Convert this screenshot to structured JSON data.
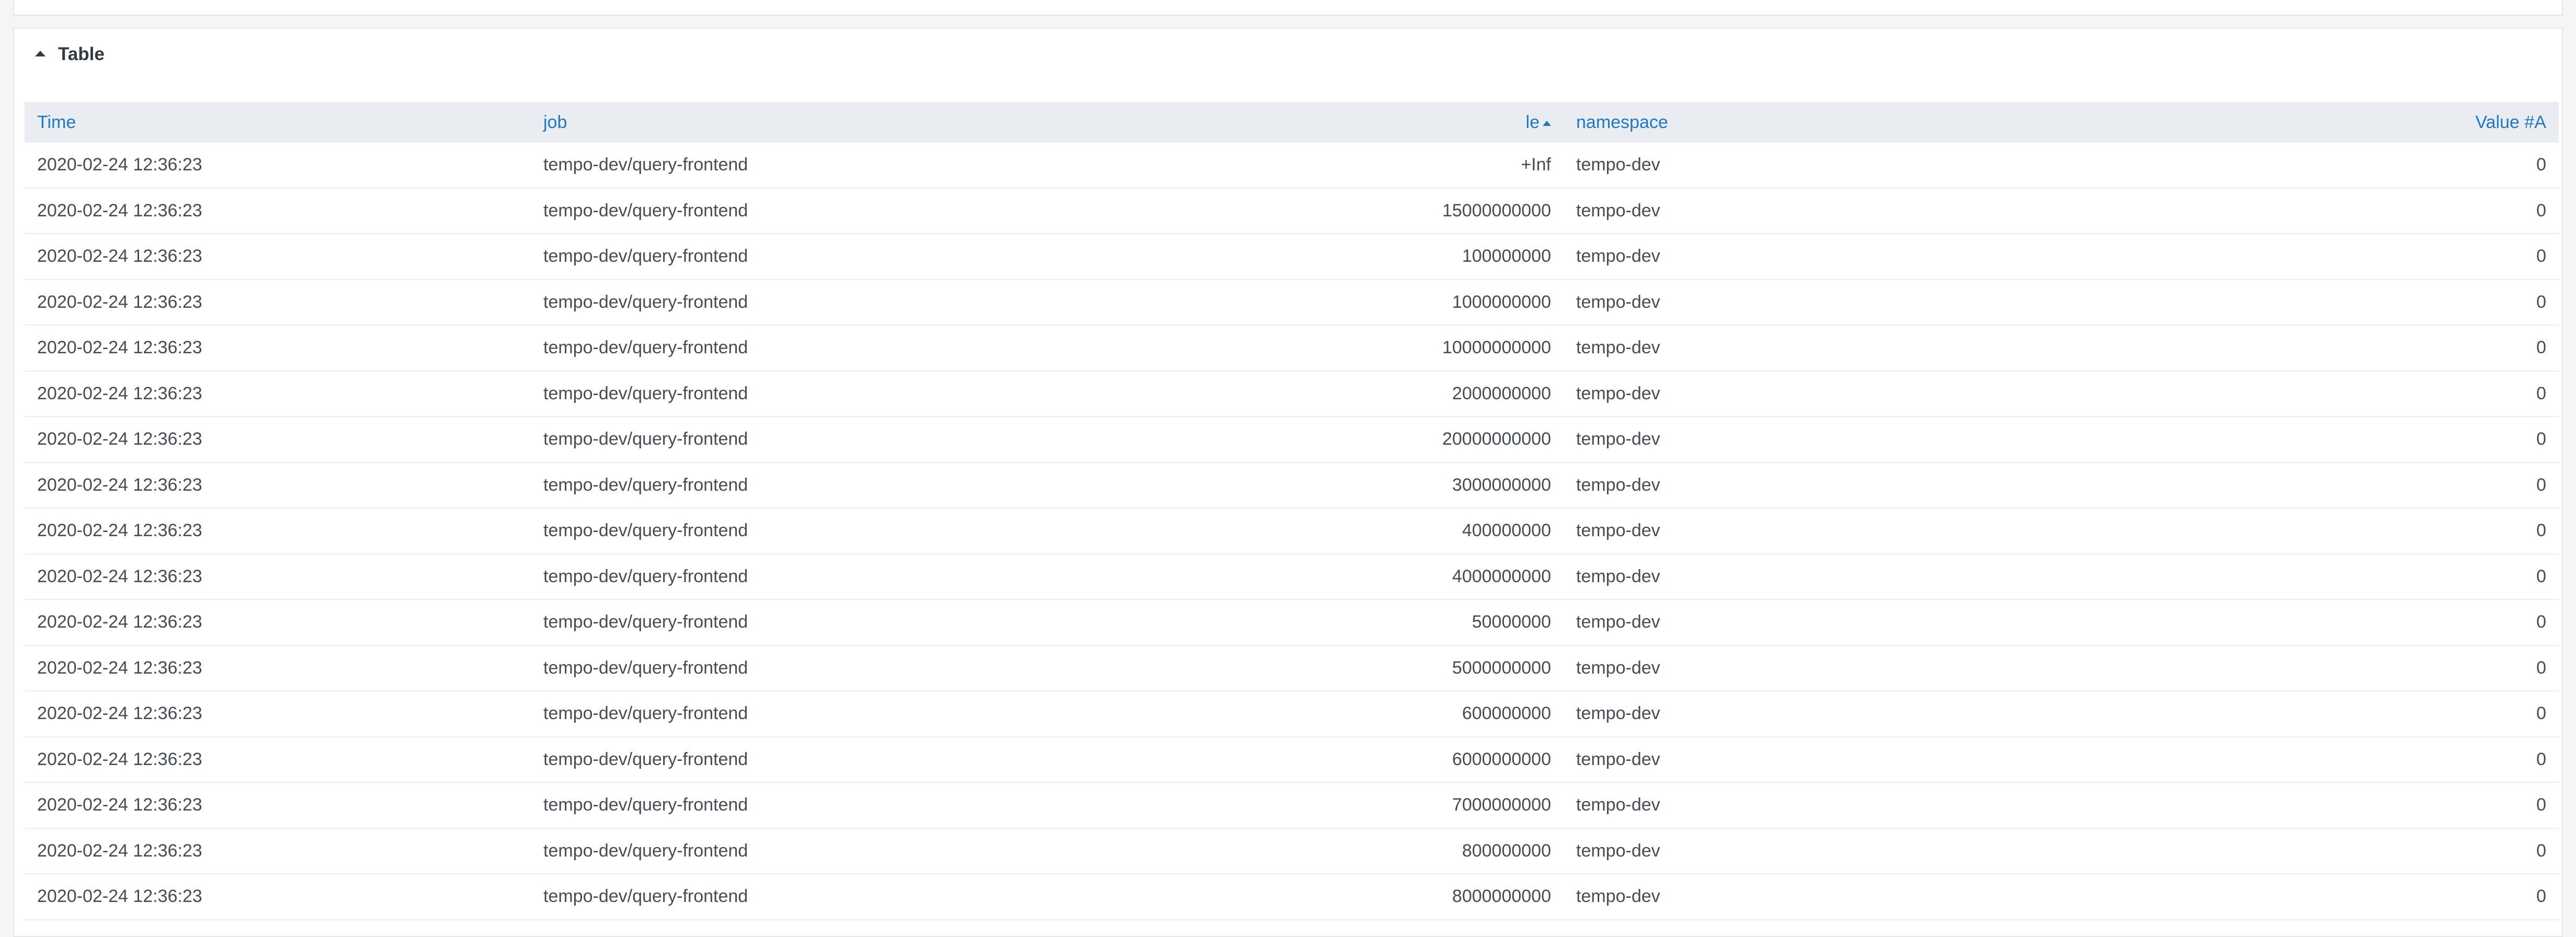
{
  "panel": {
    "title": "Table"
  },
  "table": {
    "columns": [
      "Time",
      "job",
      "le",
      "namespace",
      "Value #A"
    ],
    "rows": [
      [
        "2020-02-24 12:36:23",
        "tempo-dev/query-frontend",
        "+Inf",
        "tempo-dev",
        "0"
      ],
      [
        "2020-02-24 12:36:23",
        "tempo-dev/query-frontend",
        "15000000000",
        "tempo-dev",
        "0"
      ],
      [
        "2020-02-24 12:36:23",
        "tempo-dev/query-frontend",
        "100000000",
        "tempo-dev",
        "0"
      ],
      [
        "2020-02-24 12:36:23",
        "tempo-dev/query-frontend",
        "1000000000",
        "tempo-dev",
        "0"
      ],
      [
        "2020-02-24 12:36:23",
        "tempo-dev/query-frontend",
        "10000000000",
        "tempo-dev",
        "0"
      ],
      [
        "2020-02-24 12:36:23",
        "tempo-dev/query-frontend",
        "2000000000",
        "tempo-dev",
        "0"
      ],
      [
        "2020-02-24 12:36:23",
        "tempo-dev/query-frontend",
        "20000000000",
        "tempo-dev",
        "0"
      ],
      [
        "2020-02-24 12:36:23",
        "tempo-dev/query-frontend",
        "3000000000",
        "tempo-dev",
        "0"
      ],
      [
        "2020-02-24 12:36:23",
        "tempo-dev/query-frontend",
        "400000000",
        "tempo-dev",
        "0"
      ],
      [
        "2020-02-24 12:36:23",
        "tempo-dev/query-frontend",
        "4000000000",
        "tempo-dev",
        "0"
      ],
      [
        "2020-02-24 12:36:23",
        "tempo-dev/query-frontend",
        "50000000",
        "tempo-dev",
        "0"
      ],
      [
        "2020-02-24 12:36:23",
        "tempo-dev/query-frontend",
        "5000000000",
        "tempo-dev",
        "0"
      ],
      [
        "2020-02-24 12:36:23",
        "tempo-dev/query-frontend",
        "600000000",
        "tempo-dev",
        "0"
      ],
      [
        "2020-02-24 12:36:23",
        "tempo-dev/query-frontend",
        "6000000000",
        "tempo-dev",
        "0"
      ],
      [
        "2020-02-24 12:36:23",
        "tempo-dev/query-frontend",
        "7000000000",
        "tempo-dev",
        "0"
      ],
      [
        "2020-02-24 12:36:23",
        "tempo-dev/query-frontend",
        "800000000",
        "tempo-dev",
        "0"
      ],
      [
        "2020-02-24 12:36:23",
        "tempo-dev/query-frontend",
        "8000000000",
        "tempo-dev",
        "0"
      ]
    ]
  }
}
